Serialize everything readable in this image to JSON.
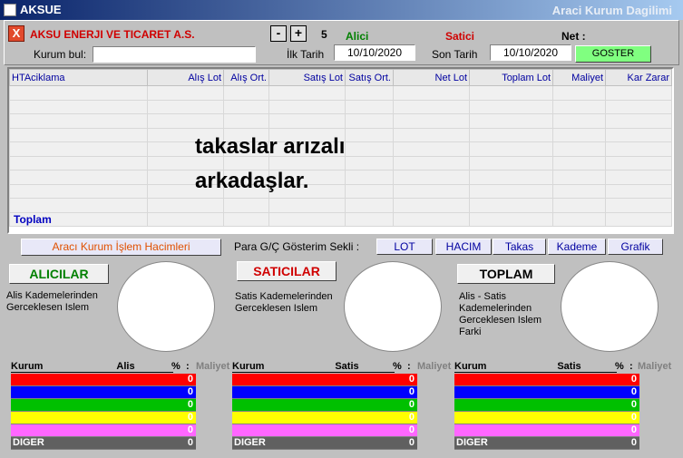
{
  "window": {
    "title": "AKSUE",
    "subtitle": "Araci Kurum Dagilimi"
  },
  "header": {
    "company": "AKSU ENERJI VE TICARET A.S.",
    "close_glyph": "X",
    "kurum_label": "Kurum bul:",
    "kurum_value": "",
    "minus_label": "-",
    "plus_label": "+",
    "counter": "5",
    "alici_label": "Alici",
    "satici_label": "Satici",
    "net_label": "Net :",
    "ilk_tarih_label": "İlk Tarih",
    "ilk_tarih_value": "10/10/2020",
    "son_tarih_label": "Son Tarih",
    "son_tarih_value": "10/10/2020",
    "goster_label": "GOSTER"
  },
  "colors": {
    "alici": "#008000",
    "satici": "#d00000",
    "goster": "#80ff80"
  },
  "grid": {
    "columns": [
      "HTAciklama",
      "Alış Lot",
      "Alış Ort.",
      "Satış Lot",
      "Satış Ort.",
      "Net Lot",
      "Toplam Lot",
      "Maliyet",
      "Kar Zarar"
    ],
    "total_label": "Toplam",
    "overlay_line1": "takaslar arızalı",
    "overlay_line2": "arkadaşlar."
  },
  "section": {
    "hacim_title": "Aracı Kurum İşlem Hacimleri",
    "para_label": "Para G/Ç Gösterim Sekli :",
    "tabs": [
      "LOT",
      "HACIM",
      "Takas",
      "Kademe",
      "Grafik"
    ],
    "alicilar_label": "ALICILAR",
    "saticilar_label": "SATICILAR",
    "toplam_label": "TOPLAM",
    "alicilar_desc1": "Alis Kademelerinden",
    "alicilar_desc2": "Gerceklesen Islem",
    "saticilar_desc1": "Satis Kademelerinden",
    "saticilar_desc2": "Gerceklesen Islem",
    "toplam_desc1": "Alis - Satis",
    "toplam_desc2": "Kademelerinden",
    "toplam_desc3": "Gerceklesen Islem",
    "toplam_desc4": "Farki"
  },
  "tables": {
    "alis": {
      "kurum": "Kurum",
      "metric": "Alis",
      "pct": "%",
      "colon": ":",
      "maliyet": "Maliyet"
    },
    "satis": {
      "kurum": "Kurum",
      "metric": "Satis",
      "pct": "%",
      "colon": ":",
      "maliyet": "Maliyet"
    },
    "toplam": {
      "kurum": "Kurum",
      "metric": "Satis",
      "pct": "%",
      "colon": ":",
      "maliyet": "Maliyet"
    },
    "rows": [
      {
        "color": "#ff0000",
        "name": "",
        "value": "0"
      },
      {
        "color": "#0000ff",
        "name": "",
        "value": "0"
      },
      {
        "color": "#00c000",
        "name": "",
        "value": "0"
      },
      {
        "color": "#ffff00",
        "name": "",
        "value": "0"
      },
      {
        "color": "#ff66ff",
        "name": "",
        "value": "0"
      },
      {
        "color": "#606060",
        "name": "DIGER",
        "value": "0"
      }
    ]
  }
}
